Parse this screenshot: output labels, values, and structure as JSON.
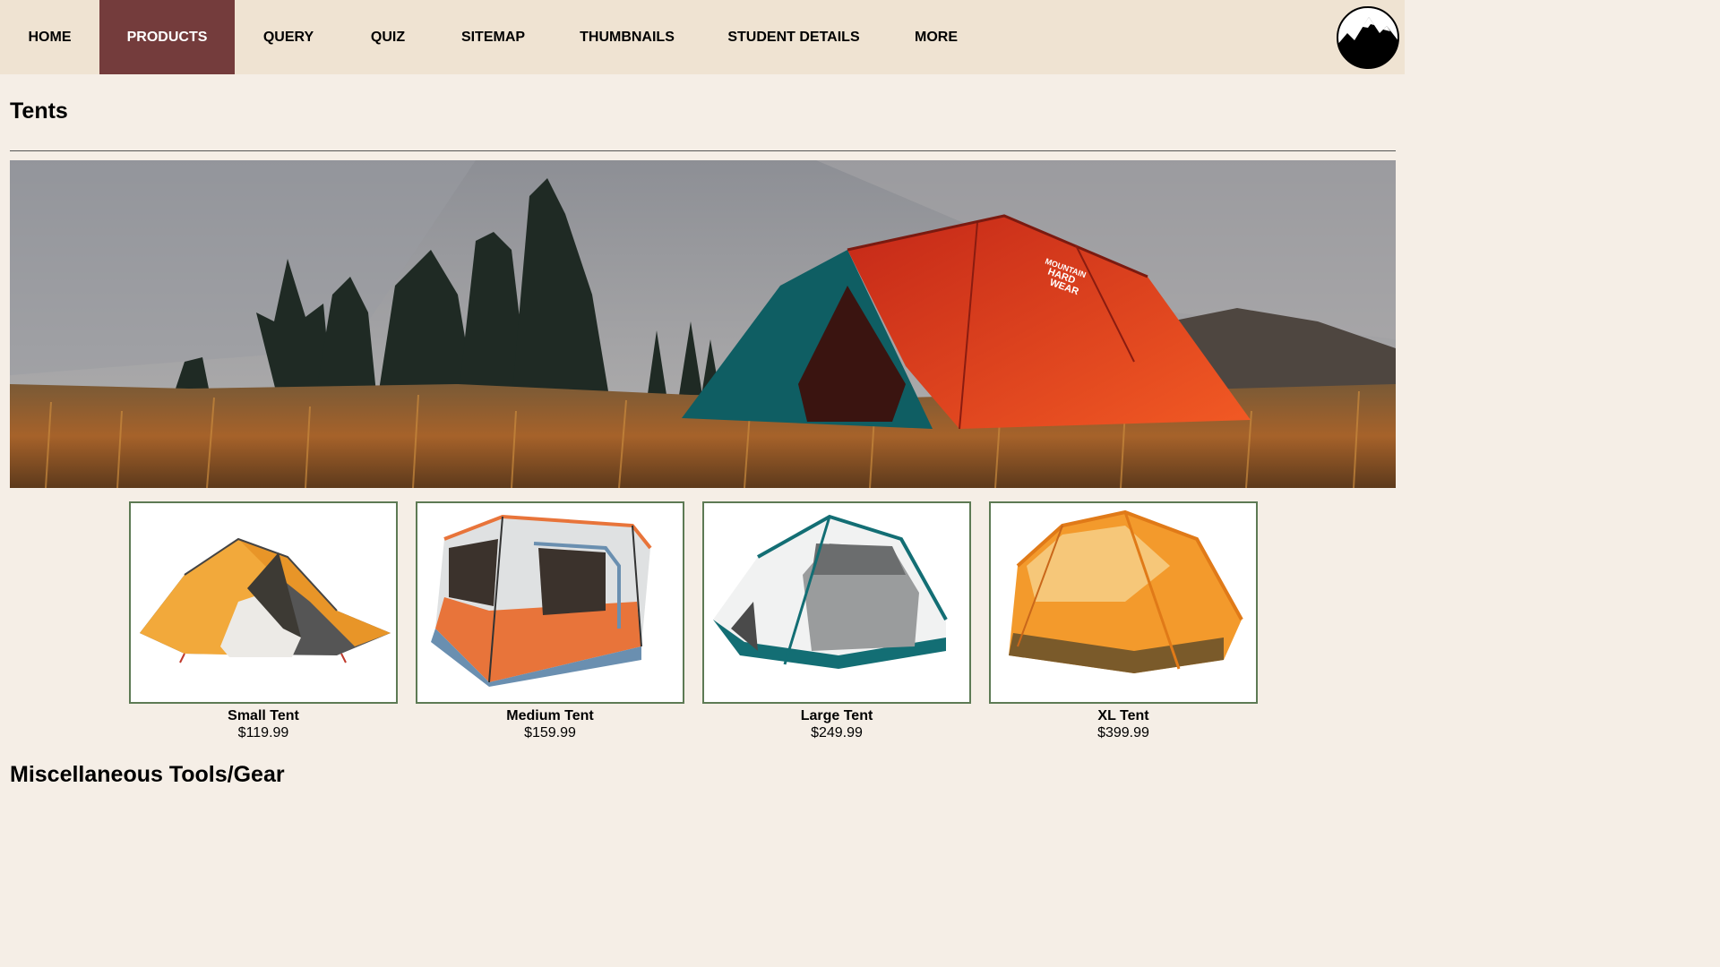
{
  "nav": {
    "items": [
      {
        "label": "HOME"
      },
      {
        "label": "PRODUCTS",
        "active": true
      },
      {
        "label": "QUERY"
      },
      {
        "label": "QUIZ"
      },
      {
        "label": "SITEMAP"
      },
      {
        "label": "THUMBNAILS"
      },
      {
        "label": "STUDENT DETAILS"
      },
      {
        "label": "MORE"
      }
    ],
    "active_color": "#743c3c",
    "background_color": "#efe3d2"
  },
  "page": {
    "title": "Tents",
    "background_color": "#f5eee6"
  },
  "hero": {
    "brand_text": [
      "MOUNTAIN",
      "HARD",
      "WEAR"
    ]
  },
  "products": [
    {
      "name": "Small Tent",
      "price": "$119.99",
      "color": "#f2a93b"
    },
    {
      "name": "Medium Tent",
      "price": "$159.99",
      "color": "#e8743a"
    },
    {
      "name": "Large Tent",
      "price": "$249.99",
      "color": "#136e74"
    },
    {
      "name": "XL Tent",
      "price": "$399.99",
      "color": "#f39a2c"
    }
  ],
  "sections": {
    "misc_title": "Miscellaneous Tools/Gear"
  }
}
